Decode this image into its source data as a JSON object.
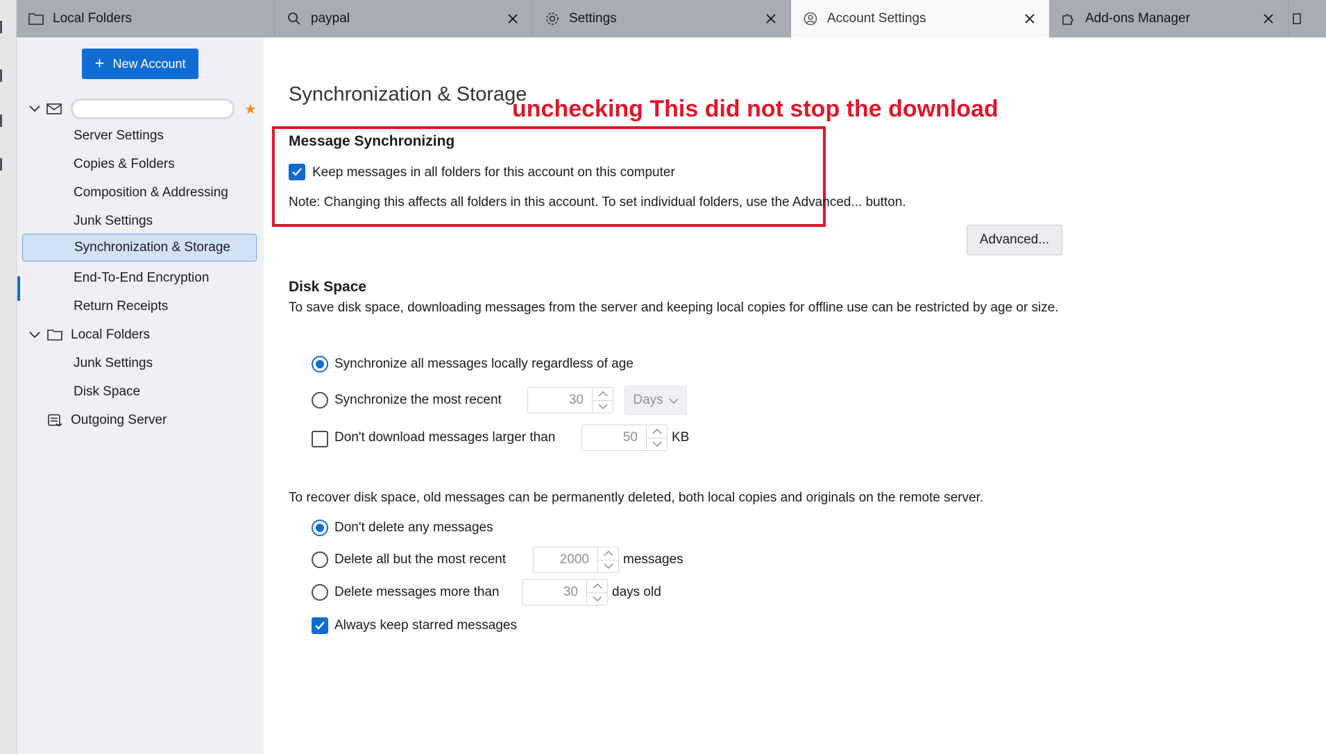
{
  "tabs": [
    {
      "label": "Local Folders",
      "icon": "folder-icon",
      "closable": false,
      "active": false
    },
    {
      "label": "paypal",
      "icon": "search-icon",
      "closable": true,
      "active": false
    },
    {
      "label": "Settings",
      "icon": "gear-icon",
      "closable": true,
      "active": false
    },
    {
      "label": "Account Settings",
      "icon": "account-settings-icon",
      "closable": true,
      "active": true
    },
    {
      "label": "Add-ons Manager",
      "icon": "puzzle-icon",
      "closable": true,
      "active": false
    }
  ],
  "sidebar": {
    "new_account_label": "New Account",
    "account_items": [
      {
        "label": "Server Settings"
      },
      {
        "label": "Copies & Folders"
      },
      {
        "label": "Composition & Addressing"
      },
      {
        "label": "Junk Settings"
      },
      {
        "label": "Synchronization & Storage",
        "selected": true
      },
      {
        "label": "End-To-End Encryption"
      },
      {
        "label": "Return Receipts"
      }
    ],
    "local_folders": {
      "label": "Local Folders",
      "items": [
        {
          "label": "Junk Settings"
        },
        {
          "label": "Disk Space"
        }
      ]
    },
    "outgoing_server_label": "Outgoing Server"
  },
  "main": {
    "title": "Synchronization & Storage",
    "annotation": "unchecking This did not stop the download",
    "sync": {
      "heading": "Message Synchronizing",
      "keep_messages_label": "Keep messages in all folders for this account on this computer",
      "keep_messages_checked": true,
      "note": "Note: Changing this affects all folders in this account. To set individual folders, use the Advanced... button.",
      "advanced_button": "Advanced..."
    },
    "disk_space": {
      "heading": "Disk Space",
      "description": "To save disk space, downloading messages from the server and keeping local copies for offline use can be restricted by age or size.",
      "sync_all_label": "Synchronize all messages locally regardless of age",
      "sync_recent_label": "Synchronize the most recent",
      "sync_recent_value": "30",
      "sync_recent_unit": "Days",
      "dont_download_label": "Don't download messages larger than",
      "dont_download_value": "50",
      "dont_download_unit": "KB",
      "recover_description": "To recover disk space, old messages can be permanently deleted, both local copies and originals on the remote server.",
      "dont_delete_label": "Don't delete any messages",
      "delete_but_recent_label": "Delete all but the most recent",
      "delete_but_recent_value": "2000",
      "delete_but_recent_unit": "messages",
      "delete_older_label": "Delete messages more than",
      "delete_older_value": "30",
      "delete_older_unit": "days old",
      "keep_starred_label": "Always keep starred messages",
      "keep_starred_checked": true
    }
  },
  "colors": {
    "accent": "#0f6cd4",
    "annotation_red": "#e0162a",
    "star": "#f08c21"
  }
}
